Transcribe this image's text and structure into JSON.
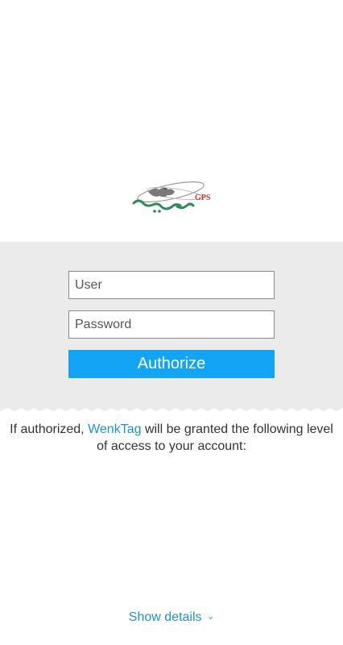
{
  "logo": {
    "name": "app-logo",
    "mark_text": "GPS"
  },
  "login": {
    "user_placeholder": "User",
    "password_placeholder": "Password",
    "authorize_label": "Authorize"
  },
  "info": {
    "prefix": "If authorized,",
    "app_name": "WenkTag",
    "suffix": "will be granted the following level of access to your account:"
  },
  "footer": {
    "show_details_label": "Show details",
    "chevron_icon": "chevron-down-icon"
  },
  "colors": {
    "accent": "#12a5f5",
    "link": "#1f8fcf",
    "panel": "#ebebeb"
  }
}
